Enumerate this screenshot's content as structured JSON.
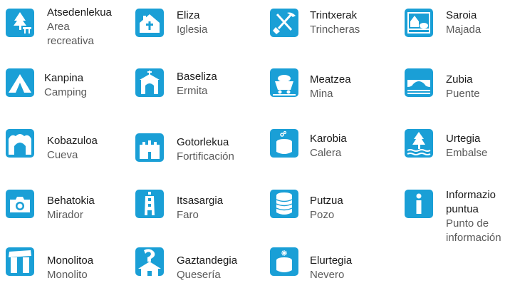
{
  "accent_color": "#1a9fd6",
  "legend": [
    {
      "icon": "picnic-table-tree-icon",
      "eu": "Atsedenlekua",
      "es": [
        "Area",
        "recreativa"
      ]
    },
    {
      "icon": "church-icon",
      "eu": "Eliza",
      "es": [
        "Iglesia"
      ]
    },
    {
      "icon": "crossed-shovel-pickaxe-icon",
      "eu": "Trintxerak",
      "es": [
        "Trincheras"
      ]
    },
    {
      "icon": "sheepfold-icon",
      "eu": "Saroia",
      "es": [
        "Majada"
      ]
    },
    {
      "icon": "tent-icon",
      "eu": "Kanpina",
      "es": [
        "Camping"
      ]
    },
    {
      "icon": "hermitage-icon",
      "eu": "Baseliza",
      "es": [
        "Ermita"
      ]
    },
    {
      "icon": "mine-cart-icon",
      "eu": "Meatzea",
      "es": [
        "Mina"
      ]
    },
    {
      "icon": "bridge-icon",
      "eu": "Zubia",
      "es": [
        "Puente"
      ]
    },
    {
      "icon": "cave-icon",
      "eu": "Kobazuloa",
      "es": [
        "Cueva"
      ]
    },
    {
      "icon": "castle-wall-icon",
      "eu": "Gotorlekua",
      "es": [
        "Fortificación"
      ]
    },
    {
      "icon": "lime-kiln-icon",
      "eu": "Karobia",
      "es": [
        "Calera"
      ]
    },
    {
      "icon": "reservoir-tree-icon",
      "eu": "Urtegia",
      "es": [
        "Embalse"
      ]
    },
    {
      "icon": "camera-icon",
      "eu": "Behatokia",
      "es": [
        "Mirador"
      ]
    },
    {
      "icon": "lighthouse-icon",
      "eu": "Itsasargia",
      "es": [
        "Faro"
      ]
    },
    {
      "icon": "well-icon",
      "eu": "Putzua",
      "es": [
        "Pozo"
      ]
    },
    {
      "icon": "info-icon",
      "eu": [
        "Informazio",
        "puntua"
      ],
      "es": [
        "Punto de",
        "información"
      ]
    },
    {
      "icon": "dolmen-icon",
      "eu": "Monolitoa",
      "es": [
        "Monolito"
      ]
    },
    {
      "icon": "cheese-dairy-icon",
      "eu": "Gaztandegia",
      "es": [
        "Quesería"
      ]
    },
    {
      "icon": "ice-house-icon",
      "eu": "Elurtegia",
      "es": [
        "Nevero"
      ]
    }
  ]
}
